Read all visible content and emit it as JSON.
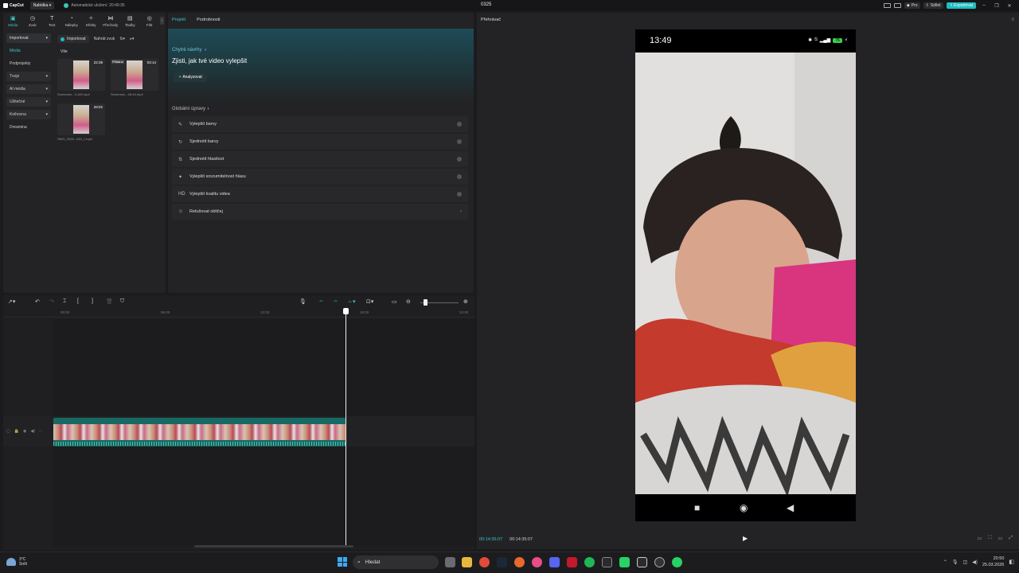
{
  "titlebar": {
    "app_name": "CapCut",
    "menu_label": "Nabídka",
    "autosave": "Automatické uložení: 20:49:35",
    "project_name": "0325",
    "pro_label": "Pro",
    "share_label": "Sdílet",
    "export_label": "Exportovat"
  },
  "media_panel": {
    "tools": [
      {
        "label": "Média",
        "icon": "media-icon",
        "glyph": "▣"
      },
      {
        "label": "Zvuk",
        "icon": "audio-icon",
        "glyph": "◷"
      },
      {
        "label": "Text",
        "icon": "text-icon",
        "glyph": "T"
      },
      {
        "label": "Nálepky",
        "icon": "sticker-icon",
        "glyph": "◔"
      },
      {
        "label": "Efekty",
        "icon": "effects-icon",
        "glyph": "✧"
      },
      {
        "label": "Přechody",
        "icon": "transitions-icon",
        "glyph": "⋈"
      },
      {
        "label": "Titulky",
        "icon": "captions-icon",
        "glyph": "▤"
      },
      {
        "label": "Filtr",
        "icon": "filter-icon",
        "glyph": "◎"
      }
    ],
    "side_nav": [
      {
        "label": "Importovat",
        "dropdown": true
      },
      {
        "label": "Média",
        "dropdown": false
      },
      {
        "label": "Podprojekty",
        "dropdown": false
      },
      {
        "label": "Tvoje",
        "dropdown": true
      },
      {
        "label": "AI média",
        "dropdown": true
      },
      {
        "label": "Užitečné",
        "dropdown": true
      },
      {
        "label": "Knihovna",
        "dropdown": true
      },
      {
        "label": "Dreamina",
        "dropdown": false
      }
    ],
    "import_button": "Importovat",
    "record_label": "Nahrát zvuk",
    "section_all": "Vše",
    "items": [
      {
        "duration": "22:39",
        "name": "Screenrec...3-182.mp4",
        "tag": ""
      },
      {
        "duration": "03:14",
        "name": "Screenrec...45-44.mp4",
        "tag": "Přidáno"
      },
      {
        "duration": "28:02",
        "name": "SWG_2026...049_1.mp4",
        "tag": ""
      }
    ]
  },
  "center_panel": {
    "tabs": [
      "Projekt",
      "Podrobnosti"
    ],
    "hero_subtitle": "Chytré návrhy",
    "hero_title": "Zjisti, jak tvé video vylepšit",
    "analyze_button": "Analyzovat",
    "global_title": "Globální úpravy",
    "options": [
      {
        "label": "Vylepšit barvy",
        "icon": "enhance-color-icon",
        "glyph": "✎",
        "kind": "toggle"
      },
      {
        "label": "Sjednotit barvy",
        "icon": "match-color-icon",
        "glyph": "↻",
        "kind": "toggle"
      },
      {
        "label": "Sjednotit hlasitost",
        "icon": "volume-icon",
        "glyph": "⇅",
        "kind": "toggle"
      },
      {
        "label": "Vylepšit srozumitelnost hlasu",
        "icon": "voice-icon",
        "glyph": "✦",
        "kind": "toggle"
      },
      {
        "label": "Vylepšit kvalitu videa",
        "icon": "hd-icon",
        "glyph": "HD",
        "kind": "toggle"
      },
      {
        "label": "Retušovat obličej",
        "icon": "face-retouch-icon",
        "glyph": "☺",
        "kind": "arrow"
      }
    ]
  },
  "timeline": {
    "ruler": [
      "00:00",
      "06:00",
      "12:00",
      "18:00",
      "24:00"
    ]
  },
  "player": {
    "title": "Přehrávač",
    "phone_time": "13:49",
    "battery": "76",
    "current_time": "00:14:35:07",
    "total_time": "00:14:35:07"
  },
  "taskbar": {
    "temperature": "3°C",
    "weather": "Sníh",
    "search_placeholder": "Hledat",
    "time": "20:50",
    "date": "25.03.2026"
  },
  "colors": {
    "accent": "#3ac7c6",
    "export": "#1fbcc1",
    "clip": "#176a63"
  }
}
